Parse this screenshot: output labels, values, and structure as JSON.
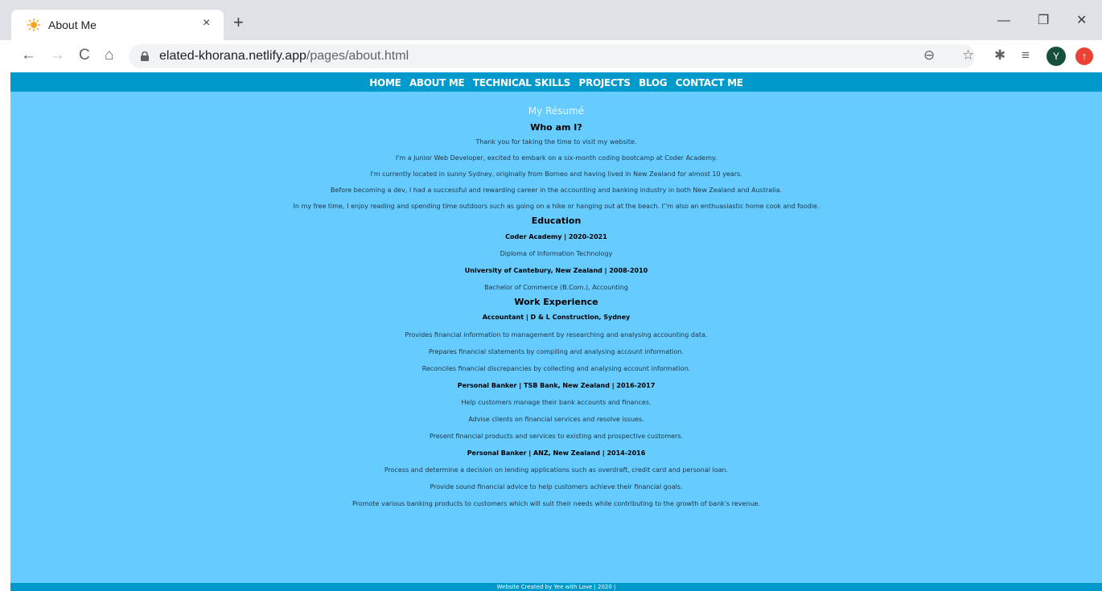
{
  "browser": {
    "tab_title": "About Me",
    "tab_close": "×",
    "new_tab": "+",
    "window_controls": {
      "minimize": "—",
      "restore": "❐",
      "close": "✕"
    },
    "nav": {
      "back": "←",
      "forward": "→",
      "reload": "C",
      "home": "⌂"
    },
    "url_host": "elated-khorana.netlify.app",
    "url_path": "/pages/about.html",
    "toolbar_icons": {
      "zoom": "⊖",
      "bookmark": "☆",
      "extensions": "✱",
      "reading_list": "≡"
    },
    "avatar_letter": "Y"
  },
  "site": {
    "nav_links": [
      "HOME",
      "ABOUT ME",
      "TECHNICAL SKILLS",
      "PROJECTS",
      "BLOG",
      "CONTACT ME"
    ],
    "resume_title": "My Résumé",
    "who_heading": "Who am I?",
    "who_lines": [
      "Thank you for taking the time to visit my website.",
      "I'm a Junior Web Developer, excited to embark on a six-month coding bootcamp at Coder Academy.",
      "I'm currently located in sunny Sydney, originally from Borneo and having lived in New Zealand for almost 10 years.",
      "Before becoming a dev, I had a successful and rewarding career in the accounting and banking industry in both New Zealand and Australia.",
      "In my free time, I enjoy reading and spending time outdoors such as going on a hike or hanging out at the beach. I''m also an enthuasiastic home cook and foodie."
    ],
    "education_heading": "Education",
    "education": [
      {
        "title": "Coder Academy | 2020-2021",
        "detail": "Diploma of Information Technology"
      },
      {
        "title": "University of Cantebury, New Zealand | 2008-2010",
        "detail": "Bachelor of Commerce (B.Com.), Accounting"
      }
    ],
    "work_heading": "Work Experience",
    "work": [
      {
        "title": "Accountant | D & L Construction, Sydney",
        "lines": [
          "Provides financial information to management by researching and analysing accounting data.",
          "Prepares financial statements by compiling and analysing account information.",
          "Reconciles financial discrepancies by collecting and analysing account information."
        ]
      },
      {
        "title": "Personal Banker | TSB Bank, New Zealand | 2016-2017",
        "lines": [
          "Help customers manage their bank accounts and finances.",
          "Advise clients on financial services and resolve issues.",
          "Present financial products and services to existing and prospective customers."
        ]
      },
      {
        "title": "Personal Banker | ANZ, New Zealand | 2014-2016",
        "lines": [
          "Process and determine a decision on lending applications such as overdraft, credit card and personal loan.",
          "Provide sound financial advice to help customers achieve their financial goals.",
          "Promote various banking products to customers which will suit their needs while contributing to the growth of bank's revenue."
        ]
      }
    ],
    "footer": "Website Created by Yee with Love | 2020 |"
  },
  "colors": {
    "nav_bg": "#0099cc",
    "page_bg": "#66ccff",
    "footer_bg": "#0099cc",
    "tabstrip_bg": "#dee1e6"
  }
}
